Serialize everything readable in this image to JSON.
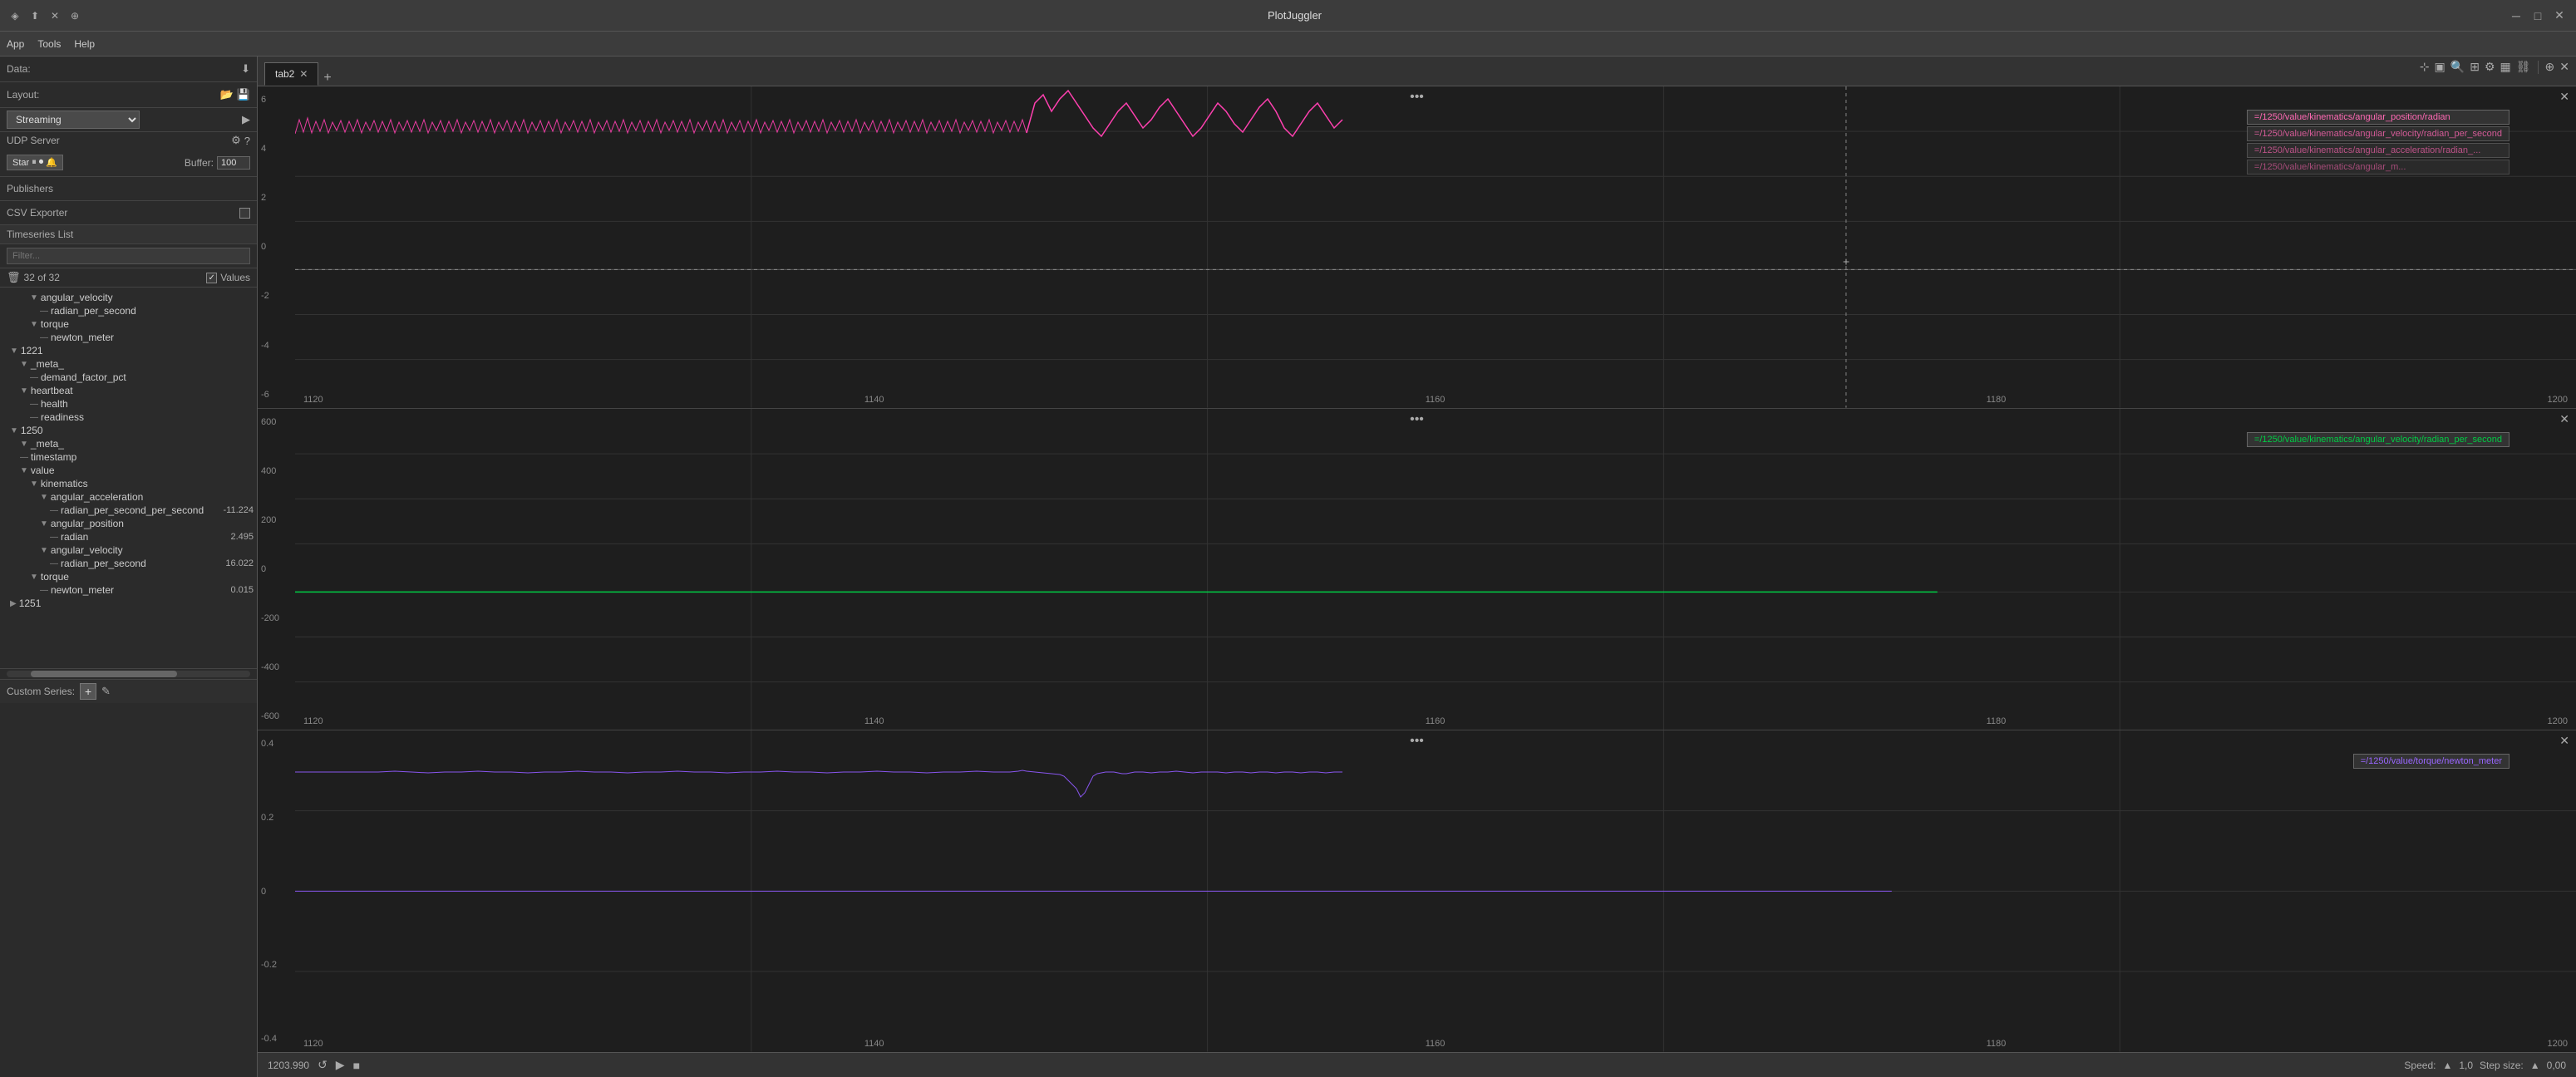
{
  "titlebar": {
    "title": "PlotJuggler",
    "icons": [
      "app-icon1",
      "app-icon2",
      "app-icon3",
      "app-icon4"
    ],
    "controls": [
      "minimize",
      "maximize",
      "close"
    ]
  },
  "menubar": {
    "items": [
      "App",
      "Tools",
      "Help"
    ]
  },
  "left_panel": {
    "data_label": "Data:",
    "layout_label": "Layout:",
    "layout_icons": [
      "load-icon",
      "save-icon"
    ],
    "streaming": {
      "label": "Streaming",
      "value": "Streaming"
    },
    "udp_server": {
      "label": "UDP Server",
      "controls": [
        "settings-icon",
        "question-icon"
      ]
    },
    "start_btn_label": "Star",
    "buffer_label": "Buffer:",
    "buffer_value": "100",
    "publishers_label": "Publishers",
    "csv_exporter_label": "CSV Exporter",
    "timeseries_label": "Timeseries List",
    "filter_placeholder": "Filter...",
    "count_label": "32 of 32",
    "values_label": "Values",
    "delete_icon": "trash",
    "tree": [
      {
        "indent": 3,
        "type": "arrow_open",
        "label": "angular_velocity",
        "value": ""
      },
      {
        "indent": 4,
        "type": "leaf",
        "label": "radian_per_second",
        "value": ""
      },
      {
        "indent": 3,
        "type": "arrow_open",
        "label": "torque",
        "value": ""
      },
      {
        "indent": 4,
        "type": "leaf",
        "label": "newton_meter",
        "value": ""
      },
      {
        "indent": 1,
        "type": "arrow_open",
        "label": "1221",
        "value": ""
      },
      {
        "indent": 2,
        "type": "arrow_open",
        "label": "_meta_",
        "value": ""
      },
      {
        "indent": 3,
        "type": "leaf",
        "label": "demand_factor_pct",
        "value": ""
      },
      {
        "indent": 2,
        "type": "arrow_open",
        "label": "heartbeat",
        "value": ""
      },
      {
        "indent": 3,
        "type": "leaf",
        "label": "health",
        "value": ""
      },
      {
        "indent": 3,
        "type": "leaf",
        "label": "readiness",
        "value": ""
      },
      {
        "indent": 1,
        "type": "arrow_open",
        "label": "1250",
        "value": ""
      },
      {
        "indent": 2,
        "type": "arrow_open",
        "label": "_meta_",
        "value": ""
      },
      {
        "indent": 2,
        "type": "leaf",
        "label": "timestamp",
        "value": ""
      },
      {
        "indent": 2,
        "type": "arrow_open",
        "label": "value",
        "value": ""
      },
      {
        "indent": 3,
        "type": "arrow_open",
        "label": "kinematics",
        "value": ""
      },
      {
        "indent": 4,
        "type": "arrow_open",
        "label": "angular_acceleration",
        "value": ""
      },
      {
        "indent": 5,
        "type": "leaf",
        "label": "radian_per_second_per_second",
        "value": "-11.224"
      },
      {
        "indent": 4,
        "type": "arrow_open",
        "label": "angular_position",
        "value": ""
      },
      {
        "indent": 5,
        "type": "leaf",
        "label": "radian",
        "value": "2.495"
      },
      {
        "indent": 4,
        "type": "arrow_open",
        "label": "angular_velocity",
        "value": ""
      },
      {
        "indent": 5,
        "type": "leaf",
        "label": "radian_per_second",
        "value": "16.022"
      },
      {
        "indent": 3,
        "type": "arrow_open",
        "label": "torque",
        "value": ""
      },
      {
        "indent": 4,
        "type": "leaf",
        "label": "newton_meter",
        "value": "0.015"
      },
      {
        "indent": 1,
        "type": "leaf",
        "label": "1251",
        "value": ""
      }
    ],
    "custom_series_label": "Custom Series:",
    "add_label": "+",
    "edit_label": "✎"
  },
  "tabs": [
    {
      "label": "tab2",
      "active": true
    }
  ],
  "toolbar_icons": [
    "move-icon",
    "select-icon",
    "zoom-icon",
    "pan-icon",
    "settings-icon",
    "grid-icon",
    "link-icon",
    "add-icon",
    "close-icon"
  ],
  "plots": [
    {
      "id": "plot1",
      "tooltip": "=/1250/value/kinematics/angular_position/radian",
      "tooltip2": "=/1250/value/kinematics/angular_velocity/radian_per_second",
      "tooltip3": "=/1250/value/kinematics/angular_acceleration/radian_...",
      "tooltip4": "=/1250/value/kinematics/angular_m...",
      "y_labels": [
        "6",
        "4",
        "2",
        "0",
        "-2",
        "-4",
        "-6"
      ],
      "x_labels": [
        "1120",
        "1140",
        "1160",
        "1180",
        "1200"
      ],
      "crosshair_x": "+"
    },
    {
      "id": "plot2",
      "tooltip": "=/1250/value/kinematics/angular_velocity/radian_per_second",
      "tooltip2": "",
      "y_labels": [
        "600",
        "400",
        "200",
        "0",
        "-200",
        "-400",
        "-600"
      ],
      "x_labels": [
        "1120",
        "1140",
        "1160",
        "1180",
        "1200"
      ]
    },
    {
      "id": "plot3",
      "tooltip": "=/1250/value/torque/newton_meter",
      "y_labels": [
        "0.4",
        "0.2",
        "0",
        "-0.2",
        "-0.4"
      ],
      "x_labels": [
        "1120",
        "1140",
        "1160",
        "1180",
        "1200"
      ]
    }
  ],
  "status_bar": {
    "time": "1203.990",
    "speed_label": "Speed:",
    "speed_value": "1,0",
    "step_label": "Step size:",
    "step_value": "0,00"
  }
}
